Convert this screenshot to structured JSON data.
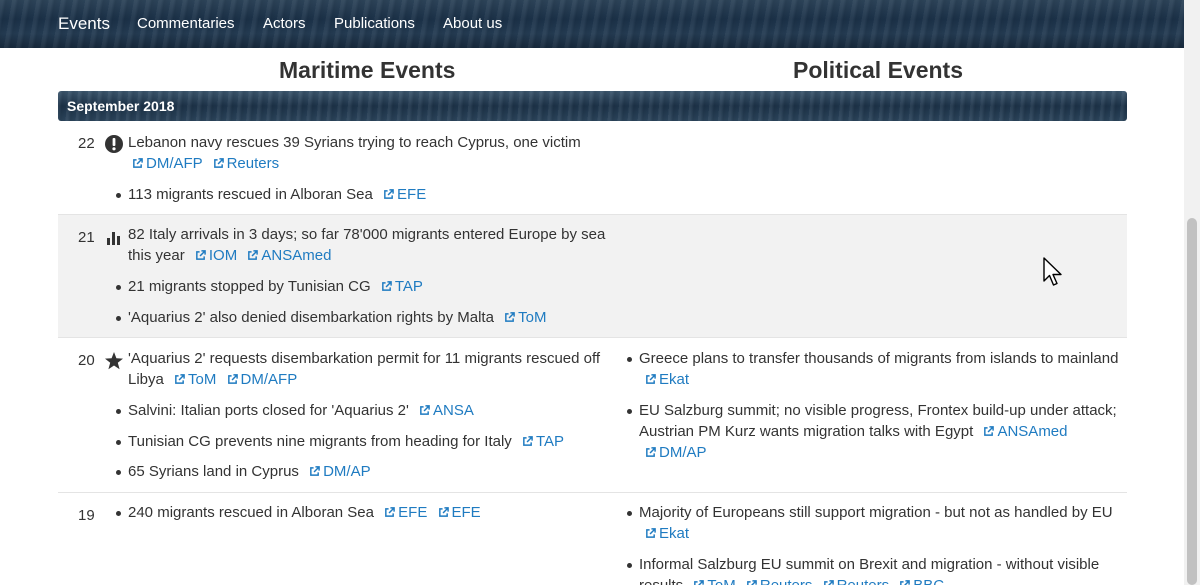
{
  "nav": {
    "brand": "Events",
    "items": [
      "Commentaries",
      "Actors",
      "Publications",
      "About us"
    ]
  },
  "columns": {
    "maritime": "Maritime Events",
    "political": "Political Events"
  },
  "month": "September 2018",
  "icons": {
    "day22": "exclamation-circle-icon",
    "day21": "bar-chart-icon",
    "day20": "star-icon",
    "source": "external-link-icon"
  },
  "colors": {
    "link": "#1f7bc1",
    "shaded_row": "#f2f2f2",
    "banner": "#1d3349"
  },
  "days": [
    {
      "day": "22",
      "maritime": [
        {
          "text": "Lebanon navy rescues 39 Syrians trying to reach Cyprus, one victim",
          "sources": [
            "DM/AFP",
            "Reuters"
          ]
        },
        {
          "text": "113 migrants rescued in Alboran Sea",
          "sources": [
            "EFE"
          ]
        }
      ],
      "political": []
    },
    {
      "day": "21",
      "maritime": [
        {
          "text": "82 Italy arrivals in 3 days; so far 78'000 migrants entered Europe by sea this year",
          "sources": [
            "IOM",
            "ANSAmed"
          ]
        },
        {
          "text": "21 migrants stopped by Tunisian CG",
          "sources": [
            "TAP"
          ]
        },
        {
          "text": "'Aquarius 2' also denied disembarkation rights by Malta",
          "sources": [
            "ToM"
          ]
        }
      ],
      "political": []
    },
    {
      "day": "20",
      "maritime": [
        {
          "text": "'Aquarius 2' requests disembarkation permit for 11 migrants rescued off Libya",
          "sources": [
            "ToM",
            "DM/AFP"
          ]
        },
        {
          "text": "Salvini: Italian ports closed for 'Aquarius 2'",
          "sources": [
            "ANSA"
          ]
        },
        {
          "text": "Tunisian CG prevents nine migrants from heading for Italy",
          "sources": [
            "TAP"
          ]
        },
        {
          "text": "65 Syrians land in Cyprus",
          "sources": [
            "DM/AP"
          ]
        }
      ],
      "political": [
        {
          "text": "Greece plans to transfer thousands of migrants from islands to mainland",
          "sources": [
            "Ekat"
          ]
        },
        {
          "text": "EU Salzburg summit; no visible progress, Frontex build-up under attack; Austrian PM Kurz wants migration talks with Egypt",
          "sources": [
            "ANSAmed",
            "DM/AP"
          ]
        }
      ]
    },
    {
      "day": "19",
      "maritime": [
        {
          "text": "240 migrants rescued in Alboran Sea",
          "sources": [
            "EFE",
            "EFE"
          ]
        }
      ],
      "political": [
        {
          "text": "Majority of Europeans still support migration - but not as handled by EU",
          "sources": [
            "Ekat"
          ]
        },
        {
          "text": "Informal Salzburg EU summit on Brexit and migration - without visible results",
          "sources": [
            "ToM",
            "Reuters",
            "Reuters",
            "BBC"
          ]
        }
      ]
    }
  ]
}
